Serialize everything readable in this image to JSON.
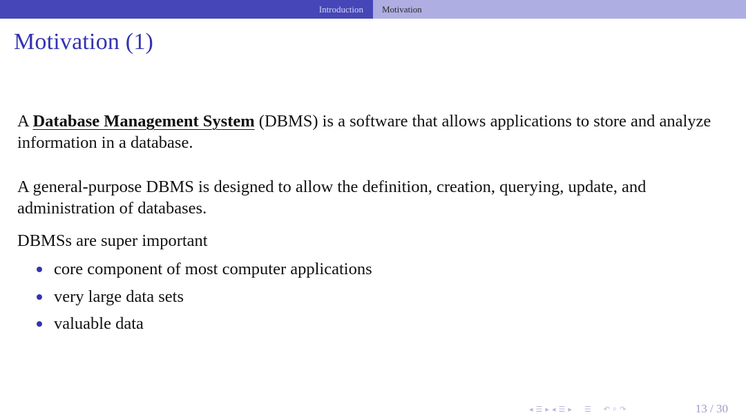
{
  "nav": {
    "sections": [
      {
        "label": "Introduction"
      },
      {
        "label": "Motivation"
      }
    ]
  },
  "frame": {
    "title": "Motivation (1)"
  },
  "content": {
    "para1": {
      "prefix": "A ",
      "term": "Database Management System",
      "suffix": " (DBMS) is a software that allows applications to store and analyze information in a database."
    },
    "para2": "A general-purpose DBMS is designed to allow the definition, creation, querying, update, and administration of databases.",
    "para3": "DBMSs are super important",
    "bullets": [
      "core component of most computer applications",
      "very large data sets",
      "valuable data"
    ]
  },
  "footer": {
    "page": "13 / 30"
  },
  "colors": {
    "nav_left_bg": "#4646b8",
    "nav_right_bg": "#aeaee2",
    "title": "#3333b2",
    "bullet": "#3333b2"
  }
}
